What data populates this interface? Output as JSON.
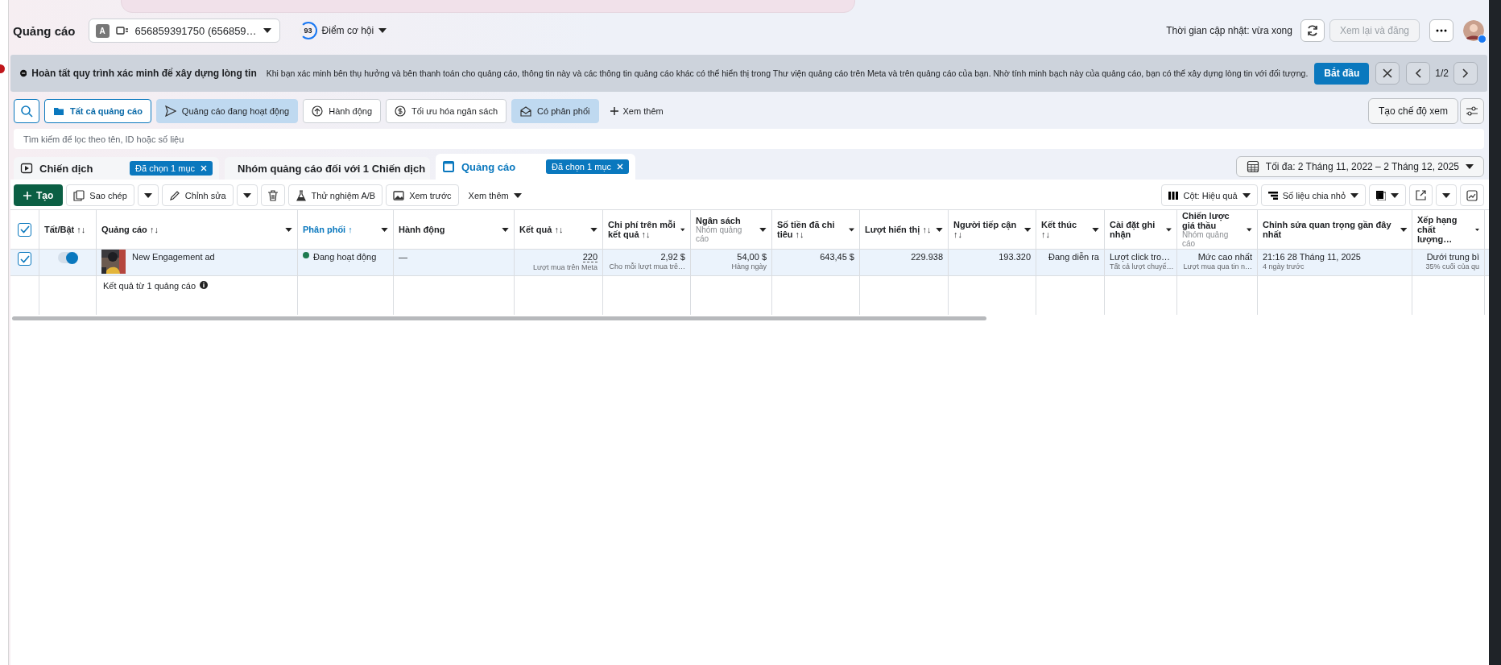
{
  "header": {
    "title": "Quảng cáo",
    "account_initial": "A",
    "account": "656859391750 (656859…",
    "score": "93",
    "score_label": "Điểm cơ hội",
    "updated": "Thời gian cập nhật: vừa xong",
    "review_button": {
      "label": "Xem lại và đăng",
      "disabled": true
    }
  },
  "banner": {
    "title": "Hoàn tất quy trình xác minh để xây dựng lòng tin",
    "text": "Khi bạn xác minh bên thụ hưởng và bên thanh toán cho quảng cáo, thông tin này và các thông tin quảng cáo khác có thể hiển thị trong Thư viện quảng cáo trên Meta và trên quảng cáo của bạn. Nhờ tính minh bạch này của quảng cáo, bạn có thể xây dựng lòng tin với đối tượng.",
    "button": "Bắt đầu",
    "pager": "1/2"
  },
  "filters": [
    {
      "label": "Tất cả quảng cáo",
      "selected": true,
      "applied": false
    },
    {
      "label": "Quảng cáo đang hoạt động",
      "selected": false,
      "applied": true
    },
    {
      "label": "Hành động",
      "selected": false,
      "applied": false
    },
    {
      "label": "Tối ưu hóa ngân sách",
      "selected": false,
      "applied": false
    },
    {
      "label": "Có phân phối",
      "selected": false,
      "applied": true
    }
  ],
  "more_filters": "Xem thêm",
  "view_button": "Tạo chế độ xem",
  "search": {
    "placeholder": "Tìm kiếm để lọc theo tên, ID hoặc số liệu"
  },
  "levels": [
    {
      "label": "Chiến dịch",
      "selected": false,
      "badge": "Đã chọn 1 mục"
    },
    {
      "label": "Nhóm quảng cáo đối với 1 Chiến dịch",
      "selected": false
    },
    {
      "label": "Quảng cáo",
      "selected": true,
      "badge": "Đã chọn 1 mục"
    }
  ],
  "date_range": "Tối đa: 2 Tháng 11, 2022 – 2 Tháng 12, 2025",
  "toolbar": {
    "create": "Tạo",
    "copy": "Sao chép",
    "edit": "Chỉnh sửa",
    "ab_test": "Thử nghiệm A/B",
    "preview": "Xem trước",
    "more": "Xem thêm",
    "columns": "Cột: Hiệu quả",
    "breakdown": "Số liệu chia nhỏ"
  },
  "table": {
    "all_selected": true,
    "columns": [
      {
        "label": "Tất/Bật ↑↓",
        "kind": "text",
        "selected": false
      },
      {
        "label": "Quảng cáo ↑↓",
        "kind": "text",
        "selected": false
      },
      {
        "label": "Phân phối ↑",
        "kind": "text",
        "selected": true
      },
      {
        "label": "Hành động",
        "kind": "text",
        "selected": false
      },
      {
        "label": "Kết quả ↑↓",
        "kind": "number",
        "selected": false
      },
      {
        "label": "Chi phí trên mỗi kết quả ↑↓",
        "kind": "number",
        "selected": false
      },
      {
        "label": "Ngân sách",
        "sub": "Nhóm quảng cáo",
        "kind": "number",
        "selected": false
      },
      {
        "label": "Số tiền đã chi tiêu ↑↓",
        "kind": "number",
        "selected": false
      },
      {
        "label": "Lượt hiển thị ↑↓",
        "kind": "number",
        "selected": false
      },
      {
        "label": "Người tiếp cận ↑↓",
        "kind": "number",
        "selected": false
      },
      {
        "label": "Kết thúc ↑↓",
        "kind": "number",
        "selected": false
      },
      {
        "label": "Cài đặt ghi nhận",
        "kind": "text",
        "selected": false
      },
      {
        "label": "Chiến lược giá thầu",
        "sub": "Nhóm quảng cáo",
        "kind": "number",
        "selected": false
      },
      {
        "label": "Chỉnh sửa quan trọng gần đây nhất",
        "kind": "text",
        "selected": false
      },
      {
        "label": "Xếp hạng chất lượng…",
        "kind": "number",
        "selected": false
      }
    ],
    "rows": [
      {
        "selected": true,
        "cells": [
          {
            "kind": "toggle",
            "on": true
          },
          {
            "kind": "ad",
            "value": "New Engagement ad"
          },
          {
            "kind": "status",
            "value": "Đang hoạt động",
            "color": "#1d7a50"
          },
          {
            "value": "—"
          },
          {
            "value": "220",
            "sub": "Lượt mua trên Meta"
          },
          {
            "value": "2,92 $",
            "sub": "Cho mỗi lượt mua trê…"
          },
          {
            "value": "54,00 $",
            "sub": "Hàng ngày"
          },
          {
            "value": "643,45 $"
          },
          {
            "value": "229.938"
          },
          {
            "value": "193.320"
          },
          {
            "value": "Đang diễn ra"
          },
          {
            "value": "Lượt click tro…",
            "sub": "Tất cả lượt chuyể…"
          },
          {
            "value": "Mức cao nhất",
            "sub": "Lượt mua qua tin n…"
          },
          {
            "value": "21:16 28 Tháng 11, 2025",
            "sub": "4 ngày trước"
          },
          {
            "value": "Dưới trung bì",
            "sub": "35% cuối của qu"
          }
        ]
      }
    ],
    "summary": "Kết quả từ 1 quảng cáo"
  }
}
